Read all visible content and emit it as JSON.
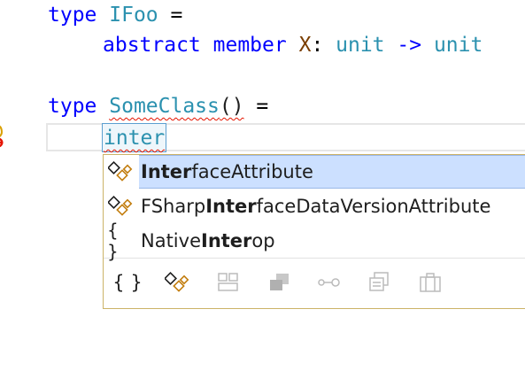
{
  "editor": {
    "lines": [
      {
        "kw": "type",
        "name": "IFoo",
        "rest": " ="
      },
      {
        "kw": "abstract member",
        "name": "X",
        "rest": ": unit -> unit"
      },
      {
        "kw": "type",
        "name": "SomeClass",
        "rest": "() ="
      }
    ],
    "typed_text": "inter",
    "line2_types": [
      "unit",
      "unit"
    ],
    "line2_arrow": "->"
  },
  "completion": {
    "items": [
      {
        "pre": "",
        "match": "Inter",
        "post": "faceAttribute",
        "icon": "attribute-class-icon",
        "selected": true
      },
      {
        "pre": "FSharp",
        "match": "Inter",
        "post": "faceDataVersionAttribute",
        "icon": "attribute-class-icon",
        "selected": false
      },
      {
        "pre": "Native",
        "match": "Inter",
        "post": "op",
        "icon": "namespace-icon",
        "selected": false
      }
    ],
    "filters": [
      {
        "name": "namespace-filter-icon",
        "glyph": "{ }"
      },
      {
        "name": "class-filter-icon"
      },
      {
        "name": "module-filter-icon"
      },
      {
        "name": "struct-filter-icon"
      },
      {
        "name": "interface-filter-icon"
      },
      {
        "name": "enum-filter-icon"
      },
      {
        "name": "type-filter-icon"
      }
    ]
  },
  "colors": {
    "keyword": "#0000ff",
    "type": "#2b91af",
    "selection": "#cce0ff",
    "squiggle": "#e51400"
  }
}
